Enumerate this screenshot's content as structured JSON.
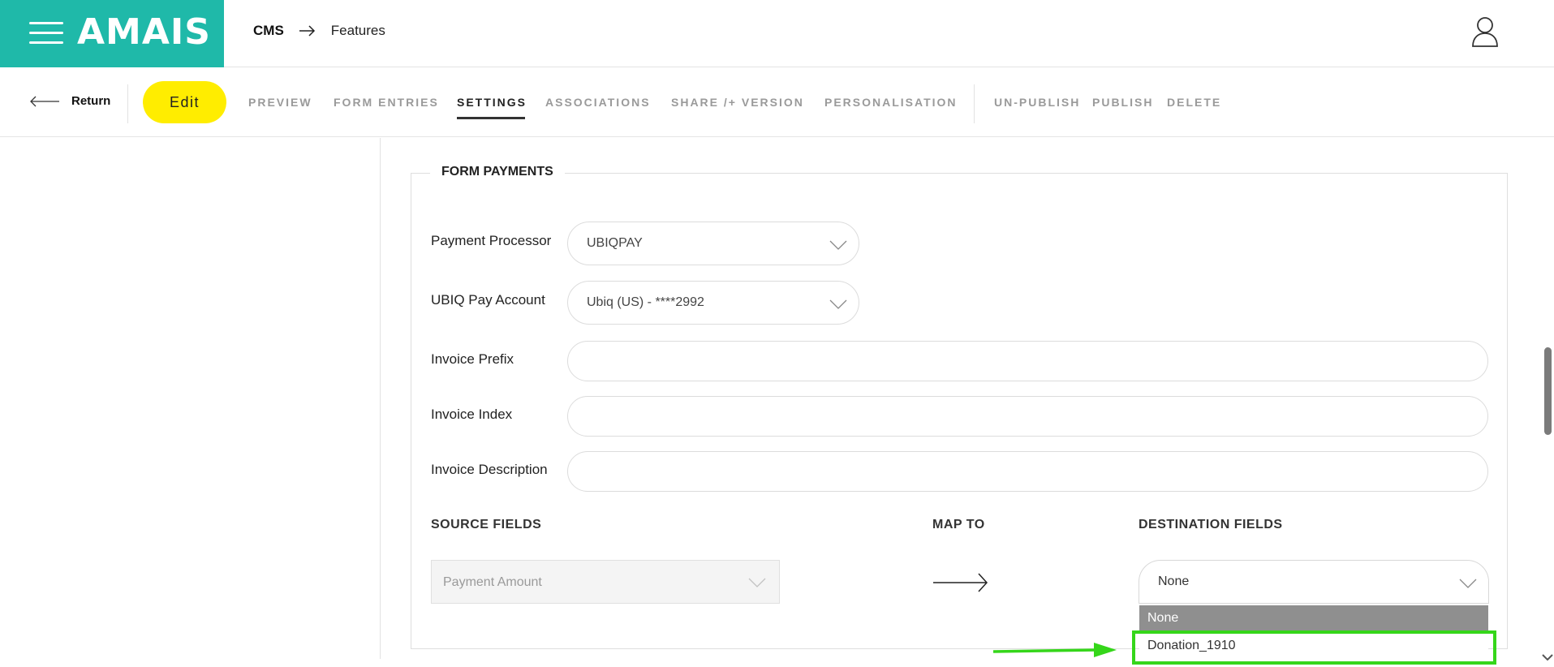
{
  "header": {
    "logo": "AMAIS",
    "breadcrumb": [
      "CMS",
      "Features"
    ]
  },
  "toolbar": {
    "return_label": "Return",
    "edit_label": "Edit",
    "tabs": [
      "PREVIEW",
      "FORM ENTRIES",
      "SETTINGS",
      "ASSOCIATIONS",
      "SHARE /+ VERSION",
      "PERSONALISATION"
    ],
    "active_tab": "SETTINGS",
    "actions": [
      "UN-PUBLISH",
      "PUBLISH",
      "DELETE"
    ]
  },
  "form_payments": {
    "legend": "FORM PAYMENTS",
    "payment_processor": {
      "label": "Payment Processor",
      "value": "UBIQPAY"
    },
    "ubiq_pay_account": {
      "label": "UBIQ Pay Account",
      "value": "Ubiq (US) - ****2992"
    },
    "invoice_prefix": {
      "label": "Invoice Prefix",
      "value": ""
    },
    "invoice_index": {
      "label": "Invoice Index",
      "value": ""
    },
    "invoice_description": {
      "label": "Invoice Description",
      "value": ""
    },
    "mapping": {
      "source_header": "SOURCE FIELDS",
      "map_header": "MAP TO",
      "destination_header": "DESTINATION FIELDS",
      "source_value": "Payment Amount",
      "destination_value": "None",
      "destination_options": [
        "None",
        "Donation_1910"
      ]
    }
  },
  "colors": {
    "brand": "#1fb9a9",
    "edit_button": "#ffed00",
    "annotation": "#35d61a",
    "selected_option": "#8f8f8f"
  },
  "icons": [
    "hamburger-icon",
    "user-icon",
    "arrow-left-icon",
    "arrow-right-icon",
    "chevron-down-icon"
  ]
}
